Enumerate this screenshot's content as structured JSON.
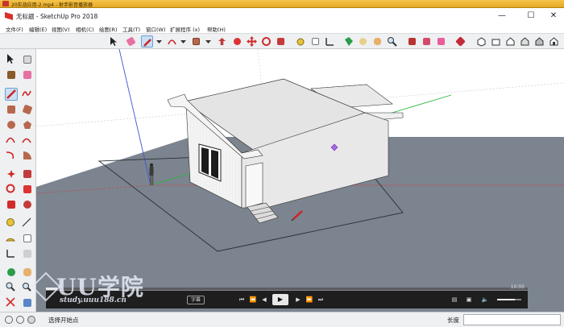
{
  "outer_window": {
    "title": "20实战应用-2.mp4 - 射手影音播放器"
  },
  "app": {
    "title": "无标题 - SketchUp Pro 2018"
  },
  "window_controls": {
    "minimize": "—",
    "maximize": "☐",
    "close": "✕"
  },
  "menu": [
    "文件(F)",
    "编辑(E)",
    "视图(V)",
    "相机(C)",
    "绘图(R)",
    "工具(T)",
    "窗口(W)",
    "扩展程序 (x)",
    "帮助(H)"
  ],
  "toolbar_icons": [
    "select-icon",
    "eraser-icon",
    "pencil-icon",
    "arc-icon",
    "rectangle-icon",
    "push-pull-icon",
    "move-icon",
    "rotate-icon",
    "offset-icon",
    "tape-measure-icon",
    "text-icon",
    "paint-bucket-icon",
    "orbit-icon",
    "pan-icon",
    "zoom-icon",
    "zoom-extents-icon",
    "warehouse-icon",
    "extension-warehouse-icon",
    "layout-icon",
    "iso-view-icon",
    "top-view-icon",
    "front-view-icon",
    "right-view-icon",
    "back-view-icon",
    "left-view-icon"
  ],
  "colors": {
    "accent": "#6aa0d4",
    "ground": "#7b848f",
    "sky": "#ffffff",
    "wall": "#f2f2f2",
    "roof": "#e5e5e5",
    "axis_red": "#d23b3b",
    "axis_green": "#2bb53b",
    "axis_blue": "#3c56d6"
  },
  "player": {
    "time": "10:05",
    "subtitle_button": "字幕"
  },
  "watermark": {
    "logo_text": "UU学院",
    "url": "study.uuu188.cn"
  },
  "status": {
    "hint": "选择开始点",
    "vcb_label": "长度",
    "vcb_value": ""
  }
}
